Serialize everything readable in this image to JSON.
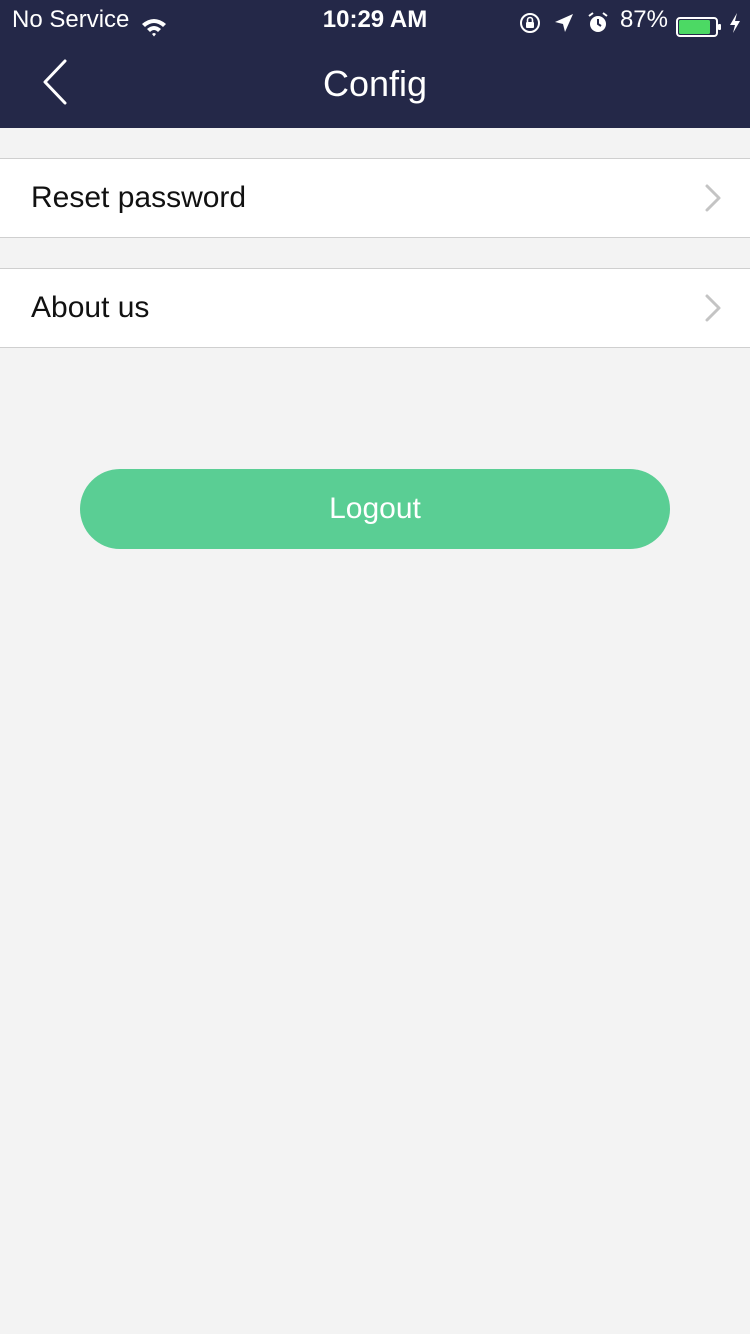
{
  "status_bar": {
    "carrier": "No Service",
    "time": "10:29 AM",
    "battery_percent": "87%",
    "battery_level": 0.87,
    "icons": [
      "wifi-icon",
      "orientation-lock-icon",
      "location-icon",
      "alarm-icon",
      "battery-icon",
      "charging-icon"
    ]
  },
  "header": {
    "title": "Config",
    "back_icon": "chevron-left-icon"
  },
  "settings": {
    "items": [
      {
        "label": "Reset password",
        "icon": "chevron-right-icon"
      },
      {
        "label": "About us",
        "icon": "chevron-right-icon"
      }
    ]
  },
  "logout": {
    "label": "Logout"
  },
  "colors": {
    "header_bg": "#242848",
    "page_bg": "#f3f3f3",
    "logout_bg": "#5ace94",
    "battery_fill": "#4cd964"
  }
}
